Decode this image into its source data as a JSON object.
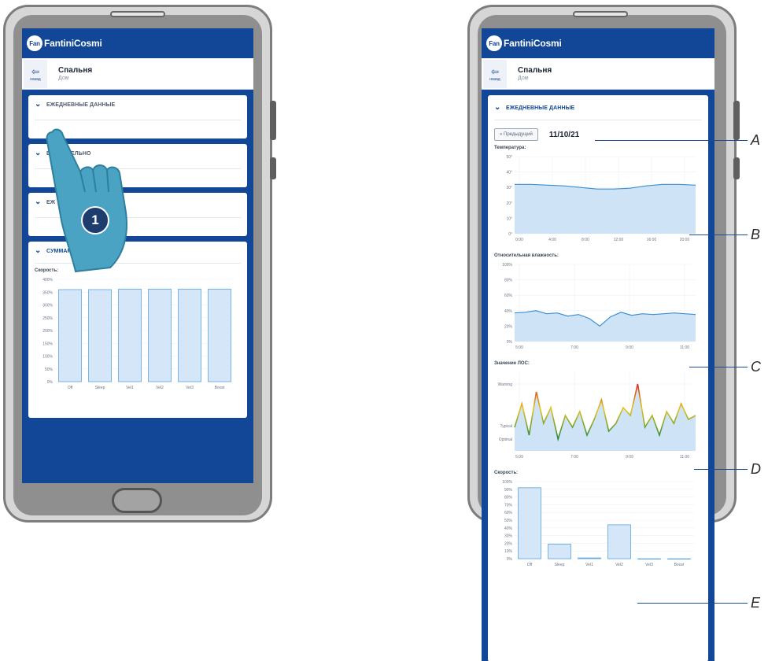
{
  "brand": {
    "logo_text": "FantiniCosmi",
    "logo_mark": "Fan"
  },
  "room": {
    "back_label": "назад",
    "title": "Спальня",
    "subtitle": "Дом"
  },
  "sections": {
    "daily": "ЕЖЕДНЕВНЫЕ ДАННЫЕ",
    "weekly": "ЕЖЕНЕДЕЛЬНО",
    "third": "ЕЖ",
    "summary": "СУММАРНЫЕ ДАННЫЕ"
  },
  "step_number": "1",
  "detail": {
    "prev_button": "« Предыдущий",
    "date": "11/10/21",
    "temp_label": "Температура:",
    "humidity_label": "Относительная влажность:",
    "voc_label": "Значение ЛОС:",
    "speed_label": "Скорость:"
  },
  "callouts": [
    "A",
    "B",
    "C",
    "D",
    "E"
  ],
  "colors": {
    "brand_blue": "#114796",
    "bar_fill": "#d4e6f7",
    "bar_stroke": "#5aa4dc",
    "area_fill": "#cfe3f6",
    "line": "#3b8fd1"
  },
  "chart_data": [
    {
      "type": "bar",
      "title": "Скорость:",
      "categories": [
        "Off",
        "Sleep",
        "Vel1",
        "Vel2",
        "Vel3",
        "Boost"
      ],
      "values": [
        360,
        360,
        362,
        362,
        362,
        362
      ],
      "yticks": [
        "400%",
        "350%",
        "300%",
        "250%",
        "200%",
        "150%",
        "100%",
        "50%",
        "0%"
      ],
      "ylim": [
        0,
        400
      ]
    },
    {
      "type": "area",
      "title": "Температура:",
      "x": [
        "0:00",
        "4:00",
        "8:00",
        "12:00",
        "16:00",
        "20:00"
      ],
      "values": [
        32,
        32,
        31.5,
        31,
        30,
        29,
        29,
        29.5,
        31,
        32,
        32,
        31.5
      ],
      "yticks": [
        "50°",
        "40°",
        "30°",
        "20°",
        "10°",
        "0°"
      ],
      "ylim": [
        0,
        50
      ]
    },
    {
      "type": "area",
      "title": "Относительная влажность:",
      "x": [
        "5:00",
        "7:00",
        "9:00",
        "11:00"
      ],
      "values": [
        37,
        38,
        40,
        36,
        37,
        33,
        35,
        30,
        20,
        32,
        38,
        34,
        36,
        35,
        36,
        37,
        36,
        35
      ],
      "yticks": [
        "100%",
        "80%",
        "60%",
        "40%",
        "20%",
        "0%"
      ],
      "ylim": [
        0,
        100
      ]
    },
    {
      "type": "area",
      "title": "Значение ЛОС:",
      "x": [
        "5:09",
        "7:00",
        "9:09",
        "11:00"
      ],
      "values": [
        30,
        60,
        20,
        75,
        35,
        55,
        15,
        45,
        30,
        50,
        20,
        40,
        65,
        25,
        35,
        55,
        45,
        85,
        30,
        45,
        20,
        50,
        35,
        60,
        40,
        45
      ],
      "yticks": [
        "Warning",
        "Typical",
        "Optimal"
      ],
      "ylim": [
        0,
        100
      ]
    },
    {
      "type": "bar",
      "title": "Скорость:",
      "categories": [
        "Off",
        "Sleep",
        "Vel1",
        "Vel2",
        "Vel3",
        "Boost"
      ],
      "values": [
        92,
        19,
        1,
        44,
        0,
        0
      ],
      "yticks": [
        "100%",
        "90%",
        "80%",
        "70%",
        "60%",
        "50%",
        "40%",
        "30%",
        "20%",
        "10%",
        "0%"
      ],
      "ylim": [
        0,
        100
      ]
    }
  ]
}
